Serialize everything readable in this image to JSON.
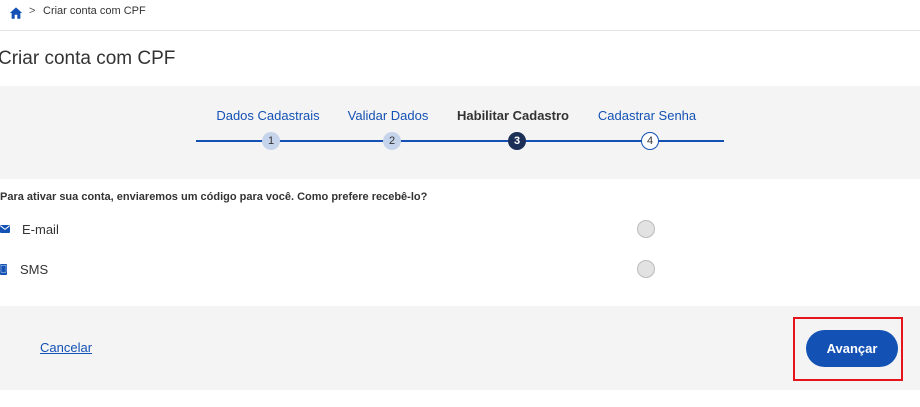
{
  "breadcrumb": {
    "home_icon": "home-icon",
    "separator": ">",
    "current": "Criar conta com CPF"
  },
  "page": {
    "title": "Criar conta com CPF"
  },
  "stepper": {
    "steps": [
      {
        "label": "Dados Cadastrais",
        "number": "1",
        "state": "done"
      },
      {
        "label": "Validar Dados",
        "number": "2",
        "state": "done"
      },
      {
        "label": "Habilitar Cadastro",
        "number": "3",
        "state": "active"
      },
      {
        "label": "Cadastrar Senha",
        "number": "4",
        "state": "todo"
      }
    ],
    "accent_color": "#1351b4",
    "active_color": "#1c2f56"
  },
  "form": {
    "question": "Para ativar sua conta, enviaremos um código para você. Como prefere recebê-lo?",
    "options": [
      {
        "icon": "envelope-icon",
        "label": "E-mail",
        "selected": false
      },
      {
        "icon": "mobile-phone-icon",
        "label": "SMS",
        "selected": false
      }
    ]
  },
  "footer": {
    "cancel_label": "Cancelar",
    "next_label": "Avançar",
    "highlight_color": "#e8141b"
  }
}
